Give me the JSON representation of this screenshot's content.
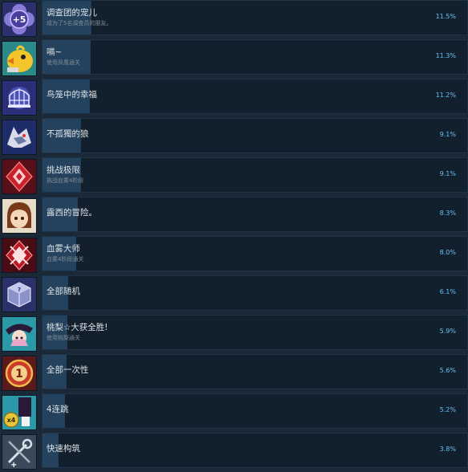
{
  "achievements": [
    {
      "icon": "plus-five-flower-icon",
      "title": "调查团的宠儿",
      "desc": "成为了5名调查员的朋友。",
      "pct": "11.5%",
      "percent": 11.5
    },
    {
      "icon": "yellow-bird-icon",
      "title": "嗝~",
      "desc": "使用凤凰通关",
      "pct": "11.3%",
      "percent": 11.3
    },
    {
      "icon": "birdcage-icon",
      "title": "鸟笼中的幸福",
      "desc": "",
      "pct": "11.2%",
      "percent": 11.2
    },
    {
      "icon": "wolf-icon",
      "title": "不孤獨的狼",
      "desc": "",
      "pct": "9.1%",
      "percent": 9.1
    },
    {
      "icon": "red-crystal-icon",
      "title": "挑战极限",
      "desc": "挑战血雾4阶段",
      "pct": "9.1%",
      "percent": 9.1
    },
    {
      "icon": "lucy-portrait-icon",
      "title": "露西的冒险。",
      "desc": "",
      "pct": "8.3%",
      "percent": 8.3
    },
    {
      "icon": "red-crystal-master-icon",
      "title": "血雾大师",
      "desc": "血雾4阶段通关",
      "pct": "8.0%",
      "percent": 8.0
    },
    {
      "icon": "random-dice-icon",
      "title": "全部随机",
      "desc": "",
      "pct": "6.1%",
      "percent": 6.1
    },
    {
      "icon": "peach-character-icon",
      "title": "桃梨☆大获全胜!",
      "desc": "使用桃梨通关",
      "pct": "5.9%",
      "percent": 5.9
    },
    {
      "icon": "number-one-medal-icon",
      "title": "全部一次性",
      "desc": "",
      "pct": "5.6%",
      "percent": 5.6
    },
    {
      "icon": "times-four-coin-icon",
      "title": "4连跳",
      "desc": "",
      "pct": "5.2%",
      "percent": 5.2
    },
    {
      "icon": "build-tools-icon",
      "title": "快速构筑",
      "desc": "",
      "pct": "3.8%",
      "percent": 3.8
    }
  ]
}
